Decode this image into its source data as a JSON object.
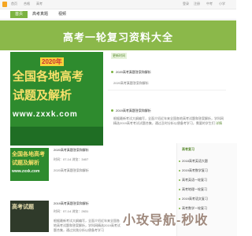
{
  "topbar": {
    "items": [
      "首页",
      "合格",
      "高考",
      "中考",
      "小学",
      "初中",
      "高中",
      "高职",
      "学习",
      "学者",
      "综合"
    ],
    "right": [
      "登录",
      "注册"
    ]
  },
  "tabs": [
    {
      "label": "首页",
      "active": true
    },
    {
      "label": "高考真题",
      "active": false
    },
    {
      "label": "视频",
      "active": false
    }
  ],
  "banner": {
    "title": "高考一轮复习资料大全"
  },
  "hero": {
    "year": "2020年",
    "line1": "全国各地高考",
    "line2": "试题及解析",
    "url": "www.zxxk.com"
  },
  "recent_label": "更新时间",
  "news": [
    {
      "title": "2020高考真题答案和解析",
      "desc": "2020高考真题答案和解析"
    },
    {
      "title": "2019高考真题答案和解析",
      "desc": "根据最新考试大纲编写，全面介绍近年来全国各地高考试题和答案解析，学科网精选2019高考考试试题合集，通过及时分析以便备考学习，需要的学生们",
      "more": "详情"
    }
  ],
  "cards": [
    {
      "title": "2020高考真题答案和解析",
      "meta": "时间：07-14    浏览：3407",
      "sub": "2020高考真题答案和解析"
    },
    {
      "title": "2019高考真题答案和解析",
      "meta": "时间：07-14    浏览：2631",
      "sub": "根据最新考试大纲编写，全面介绍近年来全国各地高考试题和答案解析，学科网精选2019高考试题合集，通过实践分析以便备考学习"
    }
  ],
  "card_images": [
    {
      "year": "2020年",
      "line1": "全国各地高考",
      "line2": "试题及解析",
      "url": "www.zxxk.com"
    },
    {
      "line1": "高考试题",
      "line2": "",
      "url": ""
    }
  ],
  "side": {
    "heading": "高考复习",
    "items": [
      "2018高考英语大题",
      "2019高考数学复习",
      "高考英语一轮复习",
      "高考地理一轮复习",
      "2019高考语文复习",
      "高考数学一轮复习"
    ]
  },
  "watermark": "小玫导航-秒收"
}
